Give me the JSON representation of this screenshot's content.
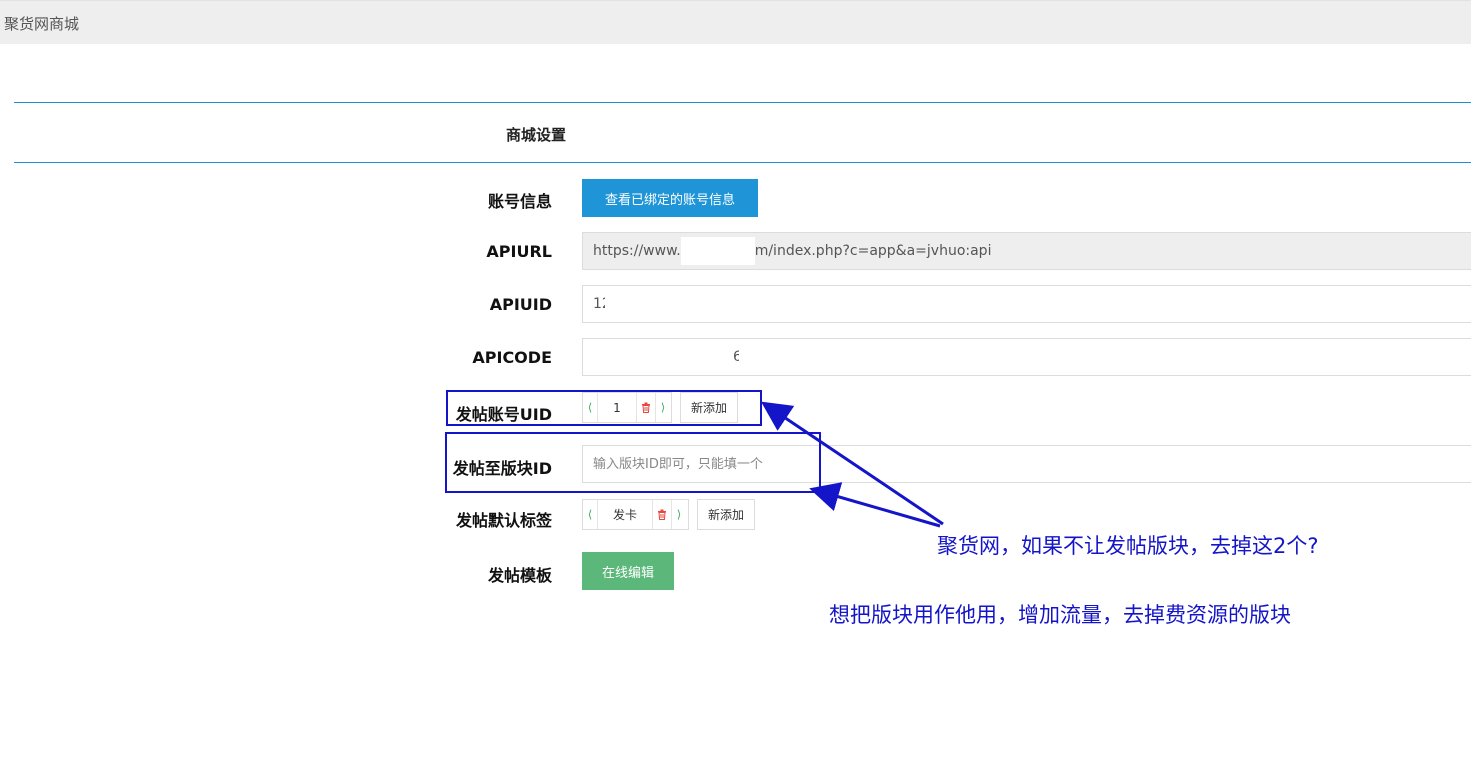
{
  "app": {
    "title": "聚货网商城"
  },
  "section": {
    "title": "商城设置"
  },
  "labels": {
    "account_info": "账号信息",
    "apiurl": "APIURL",
    "apiuid": "APIUID",
    "apicode": "APICODE",
    "post_uid": "发帖账号UID",
    "post_forum": "发帖至版块ID",
    "post_tags": "发帖默认标签",
    "post_template": "发帖模板"
  },
  "buttons": {
    "view_bound_account": "查看已绑定的账号信息",
    "online_edit": "在线编辑",
    "add_new": "新添加"
  },
  "fields": {
    "apiurl_prefix": "https://www.",
    "apiurl_suffix": "m/index.php?c=app&a=jvhuo:api",
    "apiuid_value": "12",
    "apicode_value": "6",
    "forum_placeholder": "输入版块ID即可，只能填一个"
  },
  "tags": {
    "uid_value": "1",
    "tag_value": "发卡"
  },
  "annotations": {
    "note1": "聚货网，如果不让发帖版块，去掉这2个?",
    "note2": "想把版块用作他用，增加流量，去掉费资源的版块",
    "color": "#1414c8"
  },
  "colors": {
    "primary_blue": "#1f95d8",
    "success_green": "#5cb87a",
    "tag_arrow_green": "#3aa55a",
    "delete_red": "#e8453c"
  },
  "icons": [
    "chevron-left-icon",
    "chevron-right-icon",
    "trash-icon"
  ]
}
